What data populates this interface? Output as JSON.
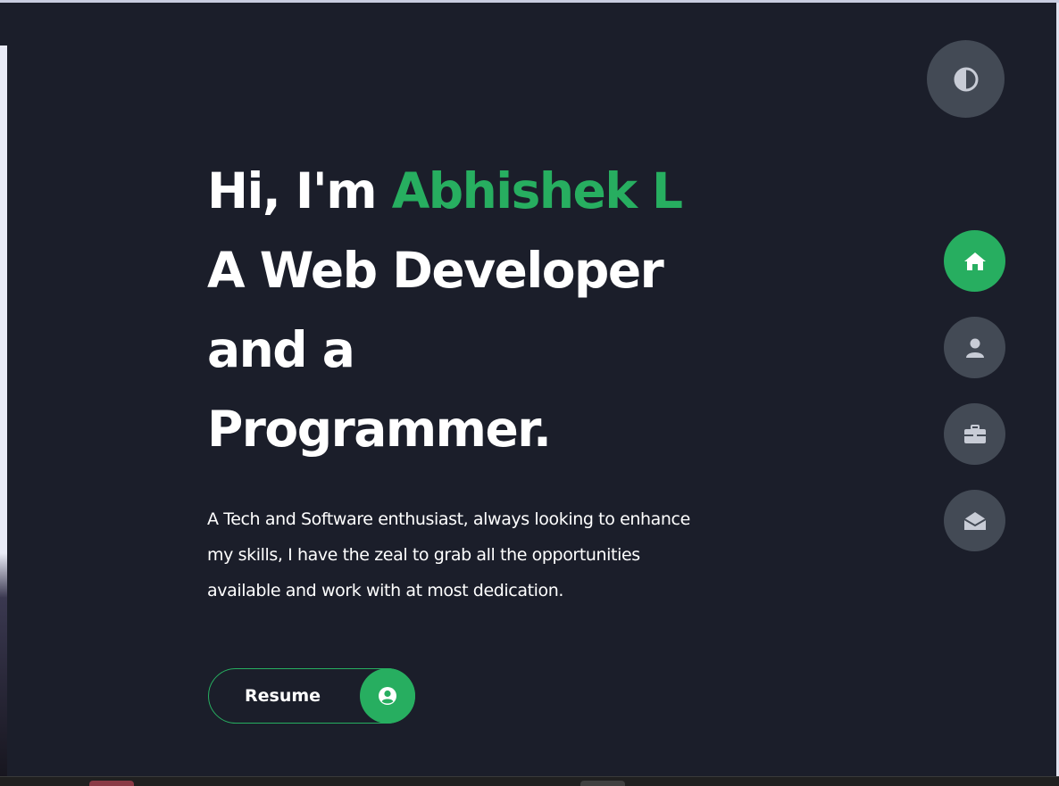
{
  "hero": {
    "greeting": "Hi, I'm ",
    "name": "Abhishek L",
    "role_line_1": "A Web Developer",
    "role_line_2": "and a",
    "role_line_3": "Programmer.",
    "intro": "A Tech and Software enthusiast, always looking to enhance my skills, I have the zeal to grab all the opportunities available and work with at most dedication."
  },
  "resume_button": {
    "label": "Resume",
    "icon": "user-circle-icon"
  },
  "theme_toggle": {
    "icon": "contrast-icon"
  },
  "side_nav": {
    "items": [
      {
        "icon": "home-icon",
        "active": true
      },
      {
        "icon": "user-icon",
        "active": false
      },
      {
        "icon": "briefcase-icon",
        "active": false
      },
      {
        "icon": "envelope-open-icon",
        "active": false
      }
    ]
  },
  "colors": {
    "background": "#1b1e2a",
    "accent": "#27ae60",
    "button_bg": "#434a55",
    "icon_gray": "#c8ccd6",
    "text": "#ffffff"
  }
}
